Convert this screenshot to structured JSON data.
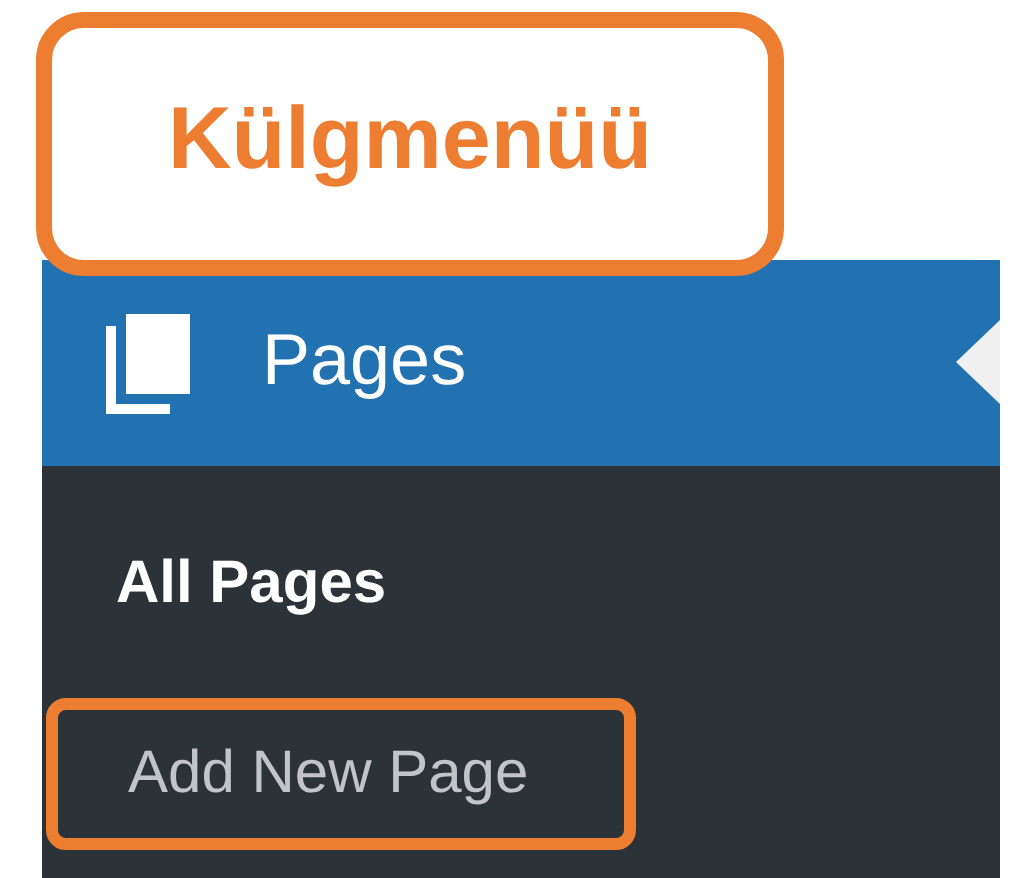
{
  "callout": {
    "label": "Külgmenüü"
  },
  "menu": {
    "label": "Pages",
    "current": true,
    "submenu": [
      {
        "label": "All Pages",
        "selected": true,
        "highlighted": false
      },
      {
        "label": "Add New Page",
        "selected": false,
        "highlighted": true
      }
    ]
  }
}
